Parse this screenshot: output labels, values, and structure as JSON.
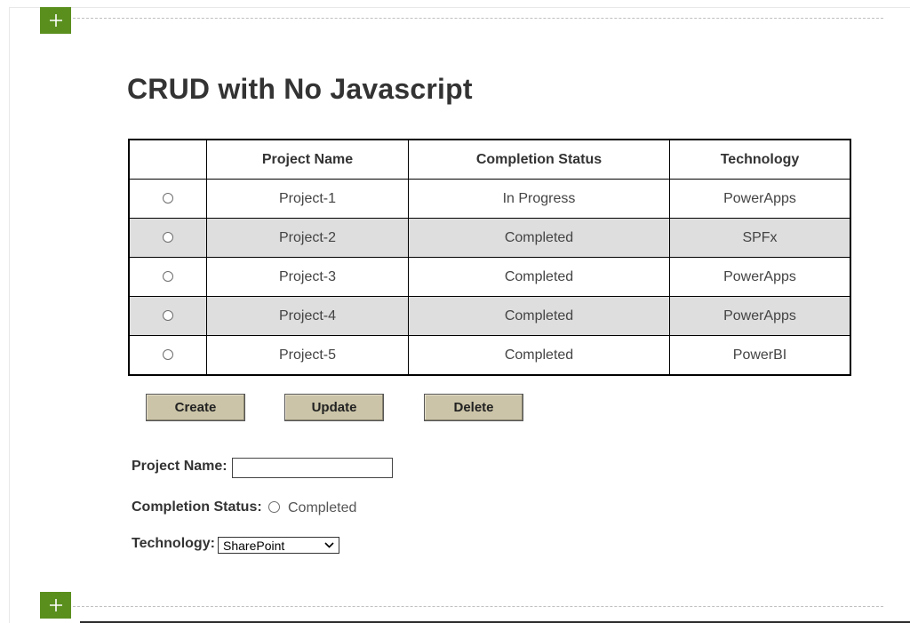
{
  "page": {
    "title": "CRUD with No Javascript",
    "corner_text": "\"\"\""
  },
  "toolbar": {
    "add_section_icon": "plus-icon",
    "accent_color": "#5a8f1e"
  },
  "table": {
    "headers": [
      "",
      "Project Name",
      "Completion Status",
      "Technology"
    ],
    "rows": [
      {
        "name": "Project-1",
        "status": "In Progress",
        "technology": "PowerApps"
      },
      {
        "name": "Project-2",
        "status": "Completed",
        "technology": "SPFx"
      },
      {
        "name": "Project-3",
        "status": "Completed",
        "technology": "PowerApps"
      },
      {
        "name": "Project-4",
        "status": "Completed",
        "technology": "PowerApps"
      },
      {
        "name": "Project-5",
        "status": "Completed",
        "technology": "PowerBI"
      }
    ],
    "shaded_row_color": "#dedede"
  },
  "actions": {
    "create_label": "Create",
    "update_label": "Update",
    "delete_label": "Delete",
    "button_color": "#cbc4a8"
  },
  "form": {
    "project_name_label": "Project Name:",
    "project_name_value": "",
    "completion_status_label": "Completion Status:",
    "completion_status_option": "Completed",
    "technology_label": "Technology:",
    "technology_selected": "SharePoint"
  }
}
